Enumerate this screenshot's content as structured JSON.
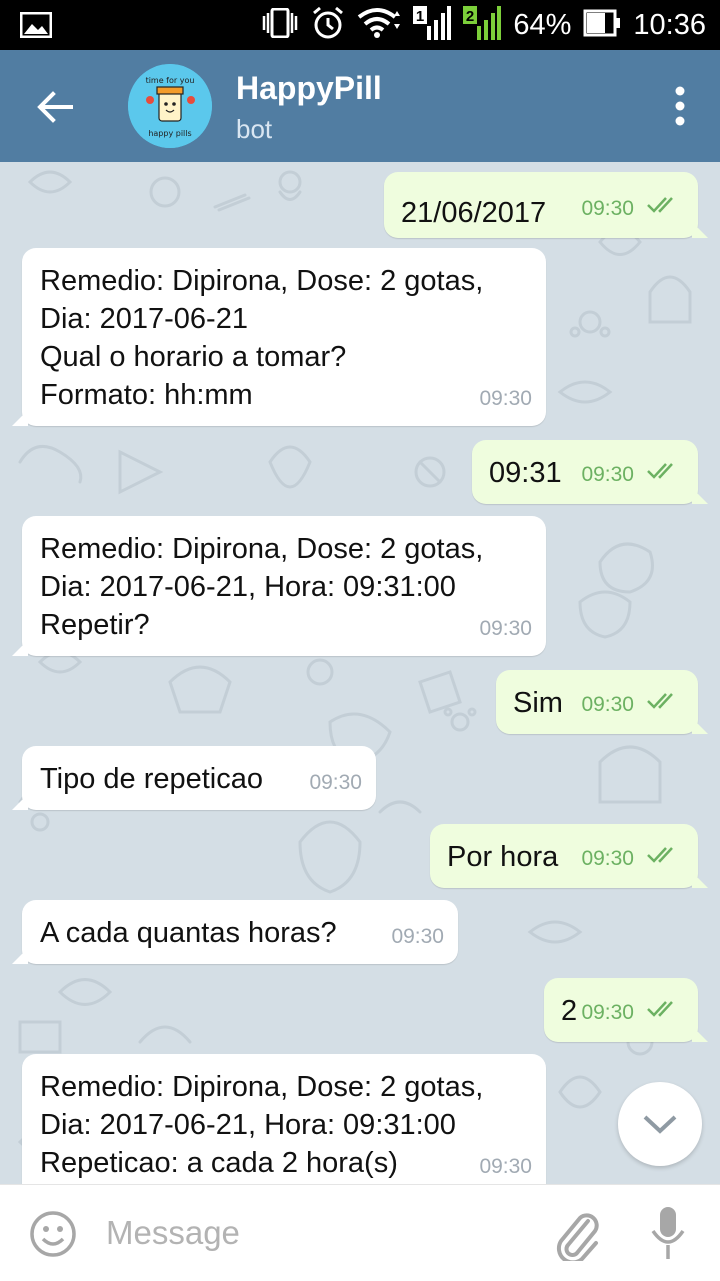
{
  "status_bar": {
    "sim1": "1",
    "sim2": "2",
    "battery": "64%",
    "time": "10:36"
  },
  "header": {
    "title": "HappyPill",
    "subtitle": "bot",
    "avatar_line1": "time for you",
    "avatar_line2": "happy pills"
  },
  "messages": [
    {
      "dir": "out",
      "text": "21/06/2017",
      "time": "09:30"
    },
    {
      "dir": "in",
      "text": "Remedio: Dipirona, Dose: 2 gotas,\nDia: 2017-06-21\nQual o horario a tomar?\nFormato: hh:mm",
      "time": "09:30"
    },
    {
      "dir": "out",
      "text": "09:31",
      "time": "09:30"
    },
    {
      "dir": "in",
      "text": "Remedio: Dipirona, Dose: 2 gotas,\nDia: 2017-06-21, Hora: 09:31:00\nRepetir?",
      "time": "09:30"
    },
    {
      "dir": "out",
      "text": "Sim",
      "time": "09:30"
    },
    {
      "dir": "in",
      "text": "Tipo de repeticao",
      "time": "09:30"
    },
    {
      "dir": "out",
      "text": "Por hora",
      "time": "09:30"
    },
    {
      "dir": "in",
      "text": "A cada quantas horas?",
      "time": "09:30"
    },
    {
      "dir": "out",
      "text": "2",
      "time": "09:30"
    },
    {
      "dir": "in",
      "text": "Remedio: Dipirona, Dose: 2 gotas,\nDia: 2017-06-21, Hora: 09:31:00\nRepeticao: a cada 2 hora(s)",
      "time": "09:30"
    }
  ],
  "input": {
    "placeholder": "Message"
  },
  "colors": {
    "header": "#517da2",
    "outgoing_bubble": "#effdde",
    "incoming_bubble": "#ffffff",
    "chat_bg": "#d4dee5",
    "read_ticks": "#6cb162"
  }
}
